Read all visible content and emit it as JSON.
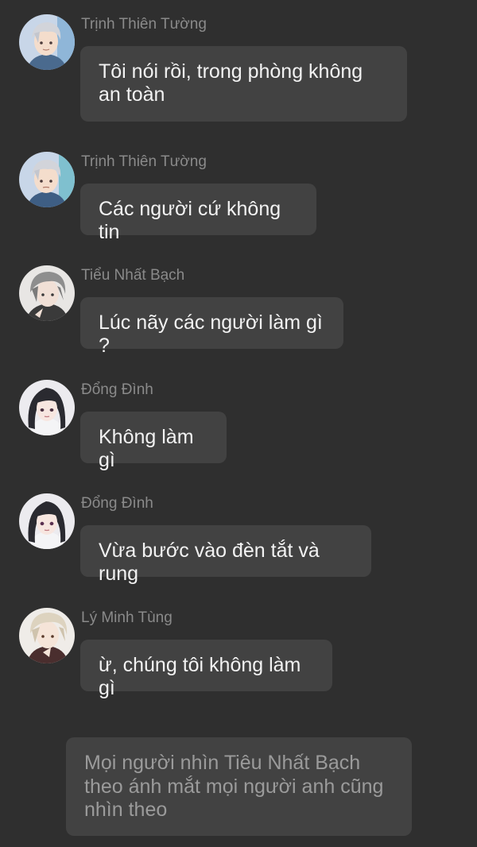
{
  "messages": [
    {
      "sender": "Trịnh Thiên Tường",
      "text": "Tôi nói rồi, trong phòng không an toàn",
      "avatar": "man-silver-hair-avatar"
    },
    {
      "sender": "Trịnh Thiên Tường",
      "text": "Các người cứ không tin",
      "avatar": "man-silver-hair-avatar"
    },
    {
      "sender": "Tiểu Nhất Bạch",
      "text": "Lúc nãy các người làm gì ?",
      "avatar": "man-grey-hair-avatar"
    },
    {
      "sender": "Đổng Đình",
      "text": "Không làm gì",
      "avatar": "woman-black-hair-avatar"
    },
    {
      "sender": "Đổng Đình",
      "text": "Vừa bước vào đèn tắt và rung",
      "avatar": "woman-black-hair-avatar"
    },
    {
      "sender": "Lý Minh Tùng",
      "text": "ừ, chúng tôi không làm gì",
      "avatar": "man-blonde-hair-avatar"
    }
  ],
  "narration": {
    "text": "Mọi người nhìn Tiêu Nhất Bạch theo ánh mắt mọi người anh cũng nhìn theo"
  },
  "colors": {
    "background": "#2f2f2f",
    "bubble": "#424242",
    "message_text": "#f2f2f2",
    "sender_text": "#8a8a8a",
    "narration_text": "#9b9b9b"
  }
}
